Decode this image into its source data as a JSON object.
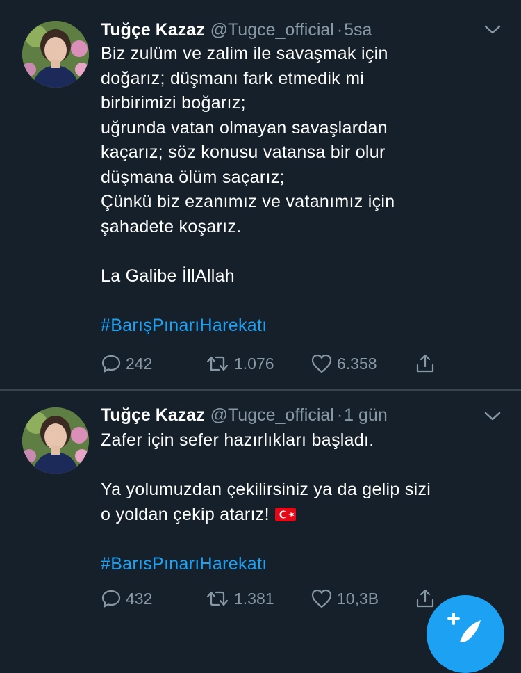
{
  "tweets": [
    {
      "author_name": "Tuğçe Kazaz",
      "handle": "@Tugce_official",
      "separator": "·",
      "time": "5sa",
      "lines": [
        "Biz zulüm ve zalim ile savaşmak için",
        "doğarız; düşmanı fark etmedik mi",
        "birbirimizi boğarız;",
        "uğrunda vatan olmayan savaşlardan",
        "kaçarız; söz konusu vatansa bir olur",
        "düşmana ölüm saçarız;",
        "Çünkü biz ezanımız ve vatanımız için",
        "şahadete koşarız."
      ],
      "line2": "La Galibe İllAllah",
      "hashtag": "#BarışPınarıHarekatı",
      "replies": "242",
      "retweets": "1.076",
      "likes": "6.358"
    },
    {
      "author_name": "Tuğçe Kazaz",
      "handle": "@Tugce_official",
      "separator": "·",
      "time": "1 gün",
      "lines": [
        "Zafer için sefer hazırlıkları başladı."
      ],
      "line2a": "Ya yolumuzdan çekilirsiniz ya da gelip sizi",
      "line2b": "o yoldan çekip atarız!",
      "flag_icon": "turkey-flag-emoji",
      "hashtag": "#BarısPınarıHarekatı",
      "replies": "432",
      "retweets": "1.381",
      "likes": "10,3B"
    }
  ],
  "colors": {
    "background": "#15202b",
    "divider": "#38444d",
    "secondary_text": "#8899a6",
    "accent": "#1da1f2"
  },
  "icons": {
    "reply": "reply-icon",
    "retweet": "retweet-icon",
    "like": "heart-icon",
    "share": "share-icon",
    "menu": "chevron-down-icon",
    "compose": "compose-tweet-icon"
  }
}
